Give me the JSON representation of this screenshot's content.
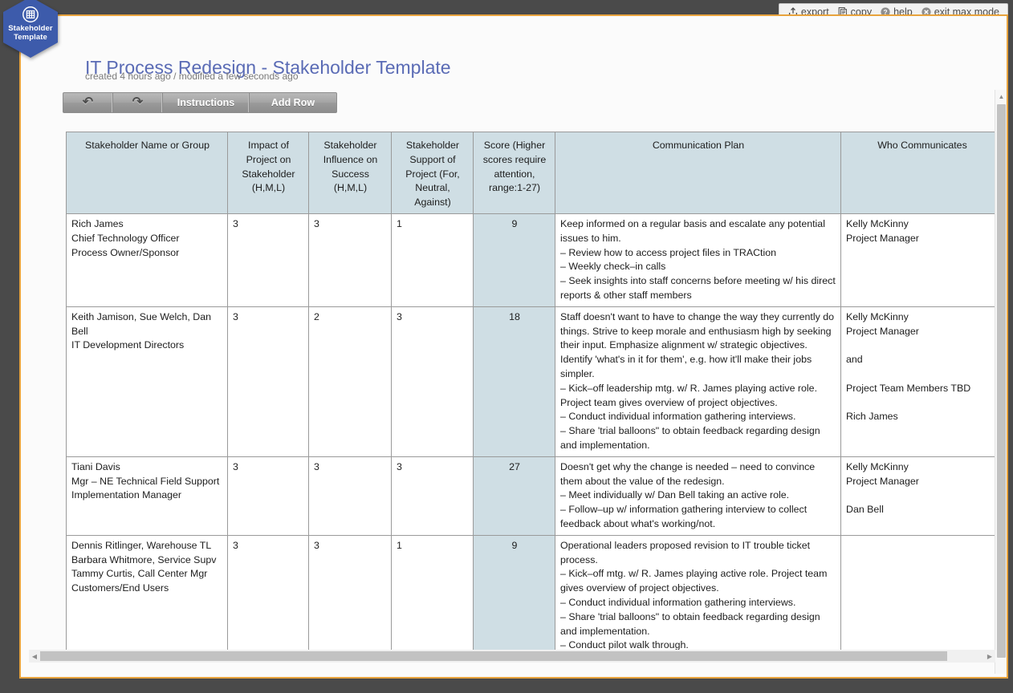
{
  "window": {
    "utility_menu": [
      {
        "icon": "export-icon",
        "label": "export"
      },
      {
        "icon": "copy-icon",
        "label": "copy"
      },
      {
        "icon": "help-icon",
        "label": "help"
      },
      {
        "icon": "exit-max-mode-icon",
        "label": "exit max mode"
      }
    ],
    "frame_accent_color": "#e8a33d",
    "frame_background_color": "#4a4a4a"
  },
  "badge": {
    "label": "Stakeholder\nTemplate",
    "icon": "grid-table-icon",
    "color": "#3d5bab"
  },
  "header": {
    "title": "IT Process Redesign - Stakeholder Template",
    "title_color": "#5a6bb5",
    "meta": "created 4 hours ago / modified a few seconds ago"
  },
  "toolbar": {
    "undo_label": "↶",
    "redo_label": "↷",
    "instructions_label": "Instructions",
    "add_row_label": "Add Row"
  },
  "table": {
    "header_background": "#cfdee4",
    "score_column_background": "#cfdee4",
    "columns": [
      "Stakeholder Name or Group",
      "Impact of Project on Stakeholder (H,M,L)",
      "Stakeholder Influence on Success (H,M,L)",
      "Stakeholder Support of Project (For, Neutral, Against)",
      "Score (Higher scores require attention, range:1-27)",
      "Communication Plan",
      "Who Communicates"
    ],
    "rows": [
      {
        "name": "Rich James\nChief Technology Officer\nProcess Owner/Sponsor",
        "impact": "3",
        "influence": "3",
        "support": "1",
        "score": "9",
        "plan": "Keep informed on a regular basis and escalate any potential issues to him.\n– Review how to access project files in TRACtion\n– Weekly check–in calls\n– Seek insights into staff concerns before meeting w/ his direct reports & other staff members",
        "who": "Kelly McKinny\nProject Manager"
      },
      {
        "name": "Keith Jamison, Sue Welch, Dan Bell\nIT Development Directors",
        "impact": "3",
        "influence": "2",
        "support": "3",
        "score": "18",
        "plan": "Staff doesn't want to have to change the way they currently do things. Strive to keep morale and enthusiasm high by seeking their input.  Emphasize alignment w/ strategic objectives.  Identify 'what's in it for them', e.g.  how it'll make their jobs simpler.\n– Kick–off leadership mtg. w/ R. James playing active role.  Project team gives overview of project objectives.\n– Conduct individual information gathering interviews.\n– Share 'trial balloons\" to obtain feedback regarding design and implementation.",
        "who": "Kelly McKinny\nProject Manager\n\nand\n\nProject Team Members TBD\n\nRich James"
      },
      {
        "name": "Tiani Davis\nMgr – NE Technical Field Support\nImplementation Manager",
        "impact": "3",
        "influence": "3",
        "support": "3",
        "score": "27",
        "plan": "Doesn't get why the change is needed – need to convince them about the value of the redesign.\n– Meet individually w/ Dan Bell taking an active role.\n– Follow–up w/ information gathering interview to collect feedback about what's working/not.",
        "who": "Kelly McKinny\nProject Manager\n\nDan Bell"
      },
      {
        "name": "Dennis Ritlinger, Warehouse TL\nBarbara Whitmore, Service Supv\nTammy Curtis, Call Center Mgr\nCustomers/End Users",
        "impact": "3",
        "influence": "3",
        "support": "1",
        "score": "9",
        "plan": "Operational leaders proposed revision to IT trouble ticket process.\n– Kick–off mtg. w/ R. James playing active role.  Project team gives overview of project objectives.\n– Conduct individual information gathering interviews.\n– Share 'trial balloons\" to obtain feedback regarding design and implementation.\n– Conduct pilot walk through.",
        "who": ""
      }
    ]
  },
  "scrollbars": {
    "vertical_up_arrow": "▲",
    "horizontal_left_arrow": "◀",
    "horizontal_right_arrow": "▶"
  }
}
